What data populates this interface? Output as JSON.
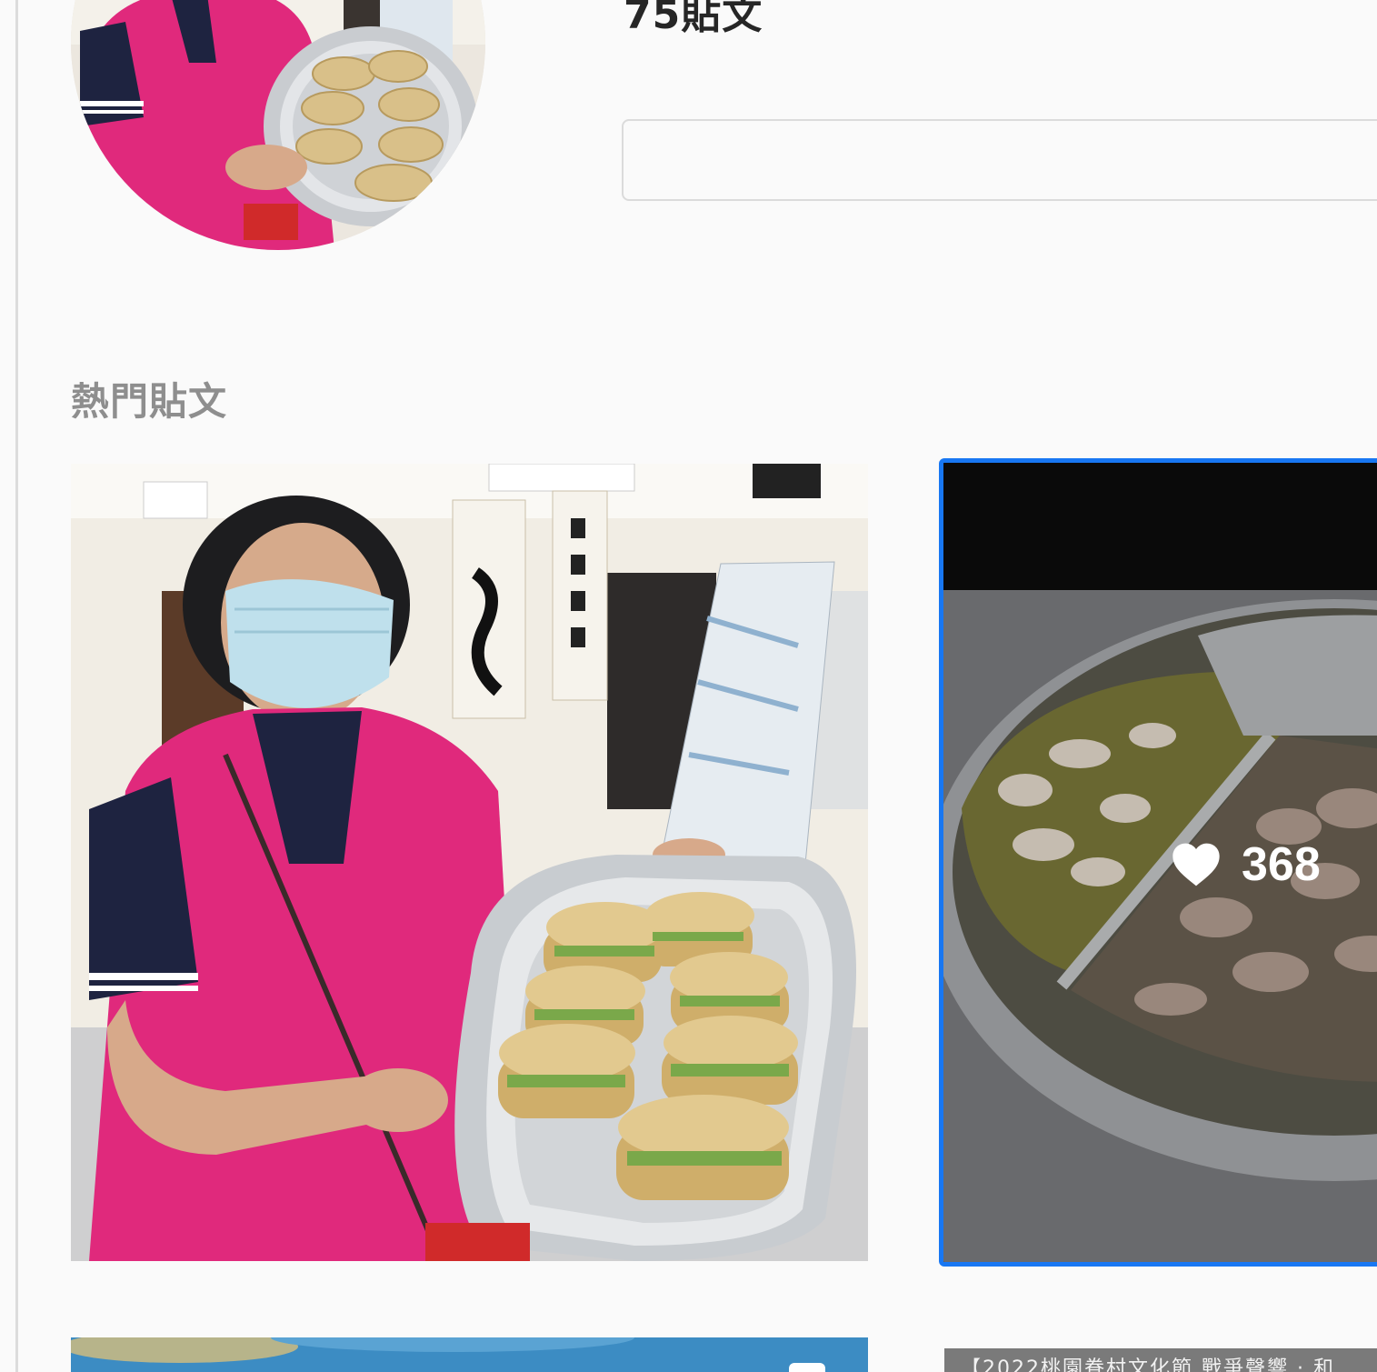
{
  "profile": {
    "post_count_label": "75貼文",
    "bio": ""
  },
  "popular": {
    "title": "熱門貼文",
    "posts": [
      {
        "image": "woman-holding-tray-of-stuffed-buns"
      },
      {
        "image": "divided-hotpot-with-sliced-meat",
        "likes": "368",
        "selected": true
      },
      {
        "image": "plate-of-dumplings-on-blue-table"
      },
      {
        "image": "event-banner",
        "caption": "【2022桃園眷村文化節 戰爭聲響 · 和"
      }
    ]
  },
  "colors": {
    "accent": "#1877f2",
    "title_gray": "#8e8e8e",
    "text": "#262626",
    "vest_pink": "#e0297c"
  }
}
